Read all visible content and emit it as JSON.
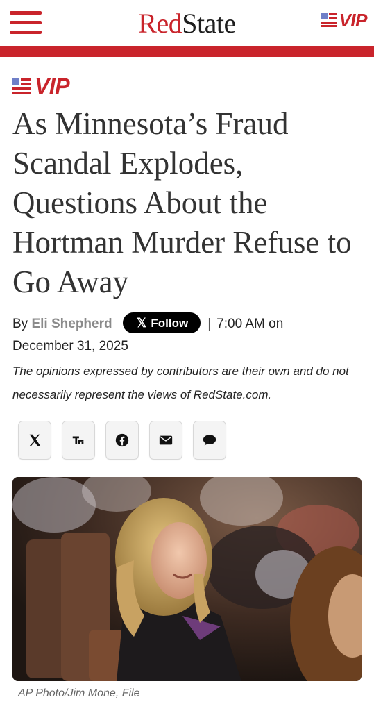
{
  "header": {
    "logo_red": "Red",
    "logo_dark": "State",
    "vip_label": "VIP"
  },
  "article": {
    "vip_label": "VIP",
    "title": "As Minnesota’s Fraud Scandal Explodes, Questions About the Hortman Murder Refuse to Go Away",
    "by_prefix": "By",
    "author": "Eli Shepherd",
    "follow_label": "Follow",
    "time": "7:00 AM on",
    "date": "December 31, 2025",
    "disclaimer": "The opinions expressed by contributors are their own and do not necessarily represent the views of RedState.com.",
    "share": [
      {
        "icon": "x-icon"
      },
      {
        "icon": "truth-social-icon"
      },
      {
        "icon": "facebook-icon"
      },
      {
        "icon": "email-icon"
      },
      {
        "icon": "comment-icon"
      }
    ],
    "photo_caption": "AP Photo/Jim Mone, File"
  },
  "colors": {
    "brand_red": "#c9242b",
    "flag_blue": "#6f7fc8",
    "title_text": "#333333",
    "author_gray": "#8a8a8a"
  }
}
